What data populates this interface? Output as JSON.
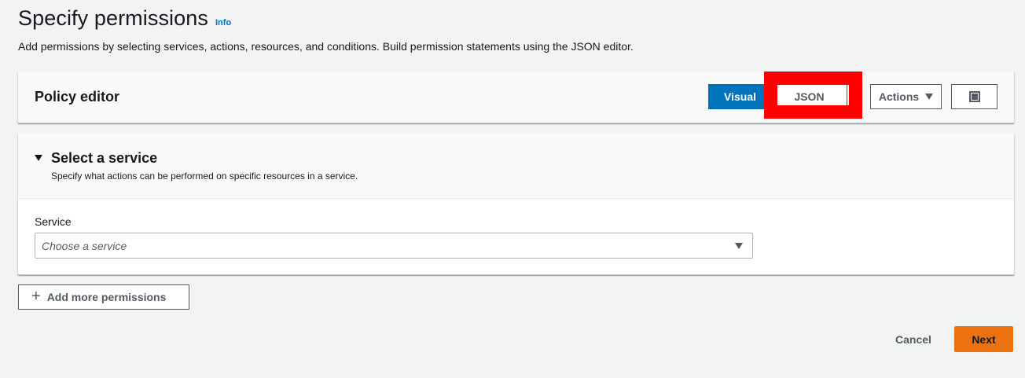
{
  "header": {
    "title": "Specify permissions",
    "info_label": "Info",
    "description": "Add permissions by selecting services, actions, resources, and conditions. Build permission statements using the JSON editor."
  },
  "policy_editor": {
    "title": "Policy editor",
    "modes": [
      {
        "label": "Visual",
        "selected": true
      },
      {
        "label": "JSON",
        "selected": false
      }
    ],
    "actions_label": "Actions",
    "highlight_color": "#ff0000"
  },
  "service_section": {
    "title": "Select a service",
    "description": "Specify what actions can be performed on specific resources in a service.",
    "service_label": "Service",
    "service_placeholder": "Choose a service"
  },
  "add_permissions_label": "Add more permissions",
  "footer": {
    "cancel_label": "Cancel",
    "next_label": "Next"
  },
  "colors": {
    "accent": "#0073bb",
    "primary_button": "#ec7211",
    "background": "#f2f3f3"
  }
}
